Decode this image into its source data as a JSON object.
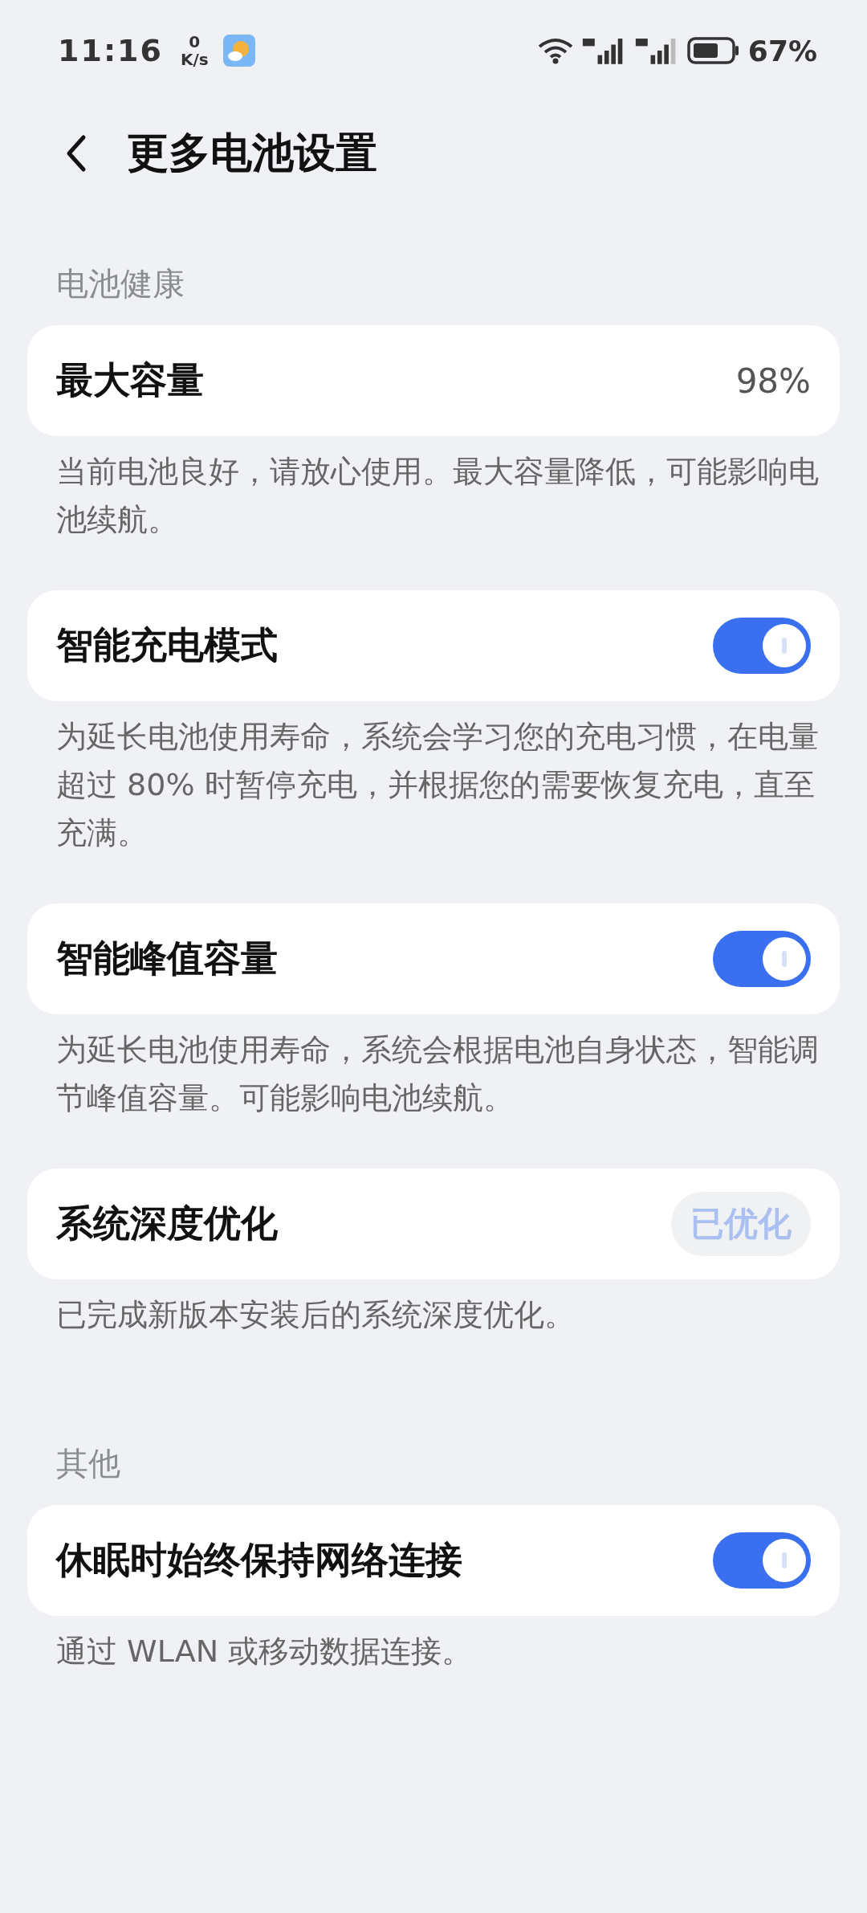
{
  "status_bar": {
    "time": "11:16",
    "net_speed_value": "0",
    "net_speed_unit": "K/s",
    "battery": "67%"
  },
  "header": {
    "title": "更多电池设置"
  },
  "sections": [
    {
      "label": "电池健康",
      "items": [
        {
          "kind": "value",
          "title": "最大容量",
          "value": "98%",
          "description": "当前电池良好，请放心使用。最大容量降低，可能影响电池续航。"
        },
        {
          "kind": "toggle",
          "title": "智能充电模式",
          "on": true,
          "description": "为延长电池使用寿命，系统会学习您的充电习惯，在电量超过 80% 时暂停充电，并根据您的需要恢复充电，直至充满。"
        },
        {
          "kind": "toggle",
          "title": "智能峰值容量",
          "on": true,
          "description": "为延长电池使用寿命，系统会根据电池自身状态，智能调节峰值容量。可能影响电池续航。"
        },
        {
          "kind": "button",
          "title": "系统深度优化",
          "button": "已优化",
          "disabled": true,
          "description": "已完成新版本安装后的系统深度优化。"
        }
      ]
    },
    {
      "label": "其他",
      "items": [
        {
          "kind": "toggle",
          "title": "休眠时始终保持网络连接",
          "on": true,
          "description": "通过 WLAN 或移动数据连接。"
        }
      ]
    }
  ]
}
